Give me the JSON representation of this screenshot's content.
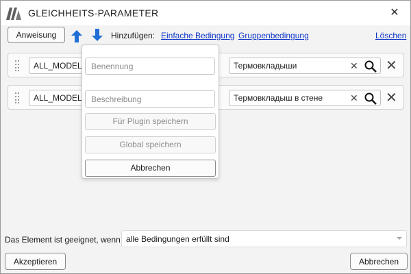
{
  "window": {
    "title": "GLEICHHEITS-PARAMETER",
    "logo_icon": "app-logo",
    "close_icon": "close-icon"
  },
  "toolbar": {
    "instruction_label": "Anweisung",
    "move_up_icon": "arrow-up-icon",
    "move_down_icon": "arrow-down-icon",
    "add_label": "Hinzufügen:",
    "simple_condition_link": "Einfache Bedingung",
    "group_condition_link": "Gruppenbedingung",
    "delete_link": "Löschen"
  },
  "conditions": [
    {
      "parameter": "ALL_MODEL_",
      "value": "Термовкладыши"
    },
    {
      "parameter": "ALL_MODEL_",
      "value": "Термовкладыш в стене"
    }
  ],
  "save_popup": {
    "name_placeholder": "Benennung",
    "description_placeholder": "Beschreibung",
    "save_plugin_label": "Für Plugin speichern",
    "save_global_label": "Global speichern",
    "cancel_label": "Abbrechen"
  },
  "footer": {
    "eligibility_label": "Das Element ist geeignet, wenn",
    "eligibility_value": "alle Bedingungen erfüllt sind",
    "accept_label": "Akzeptieren",
    "cancel_label": "Abbrechen"
  },
  "colors": {
    "accent_blue": "#1f6fd6",
    "link_blue": "#0b33c8",
    "logo_gray": "#5f5f5f"
  }
}
